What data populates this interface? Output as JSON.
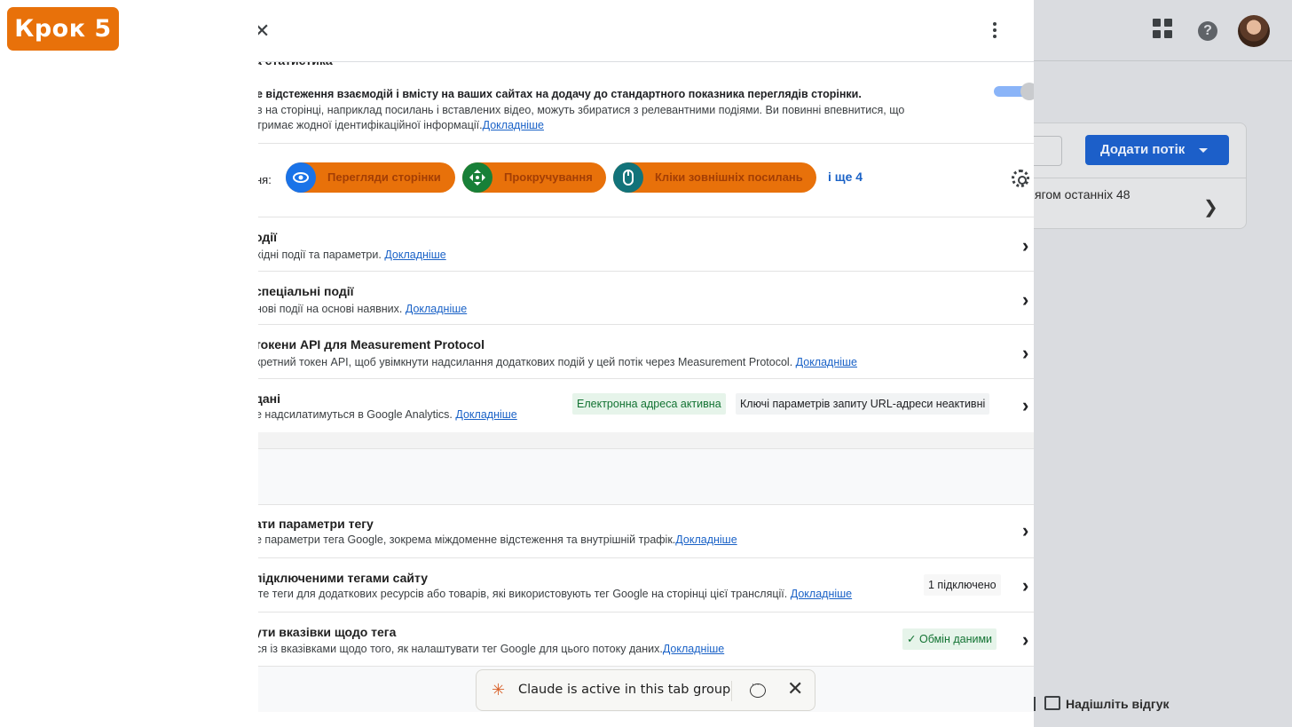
{
  "step_badge": "Крок 5",
  "panel": {
    "close_glyph": "✕",
    "enhanced_measurement": {
      "title_partial": "а статистика",
      "desc_line1": "е відстеження взаємодій і вмісту на ваших сайтах на додачу до стандартного показника переглядів сторінки.",
      "desc_line2": "в на сторінці, наприклад посилань і вставлених відео, можуть збиратися з релевантними подіями. Ви повинні впевнитися, що",
      "desc_line3": "тримає жодної ідентифікаційної інформації.",
      "learn_more": "Докладніше",
      "toggle_on": true
    },
    "measuring": {
      "label": "ня:",
      "pills": [
        {
          "label": "Перегляди сторінки",
          "icon": "eye-icon",
          "color": "#1a73e8"
        },
        {
          "label": "Прокручування",
          "icon": "scroll-arrows-icon",
          "color": "#188038"
        },
        {
          "label": "Кліки зовнішніх посилань",
          "icon": "mouse-icon",
          "color": "#12737a"
        }
      ],
      "more": "і ще 4"
    },
    "rows": [
      {
        "title": "одії",
        "desc": "хідні події та параметри. ",
        "link": "Докладніше"
      },
      {
        "title": "спеціальні події",
        "desc": "нові події на основі наявних. ",
        "link": "Докладніше"
      },
      {
        "title": "токени API для Measurement Protocol",
        "desc": "кретний токен API, щоб увімкнути надсилання додаткових подій у цей потік через Measurement Protocol. ",
        "link": "Докладніше"
      },
      {
        "title": "дані",
        "desc": "е надсилатимуться в Google Analytics. ",
        "link": "Докладніше",
        "chip_green": "Електронна адреса активна",
        "chip_grey": "Ключі параметрів запиту URL-адреси неактивні"
      }
    ],
    "tag_rows": [
      {
        "title": "ати параметри тегу",
        "desc": "е параметри тега Google, зокрема міждоменне відстеження та внутрішній трафік.",
        "link": "Докладніше"
      },
      {
        "title": "підключеними тегами сайту",
        "desc": "іте теги для додаткових ресурсів або товарів, які використовують тег Google на сторінці цієї трансляції. ",
        "link": "Докладніше",
        "chip": "1 підключено"
      },
      {
        "title": "ути вказівки щодо тега",
        "desc": "ся із вказівками щодо того, як налаштувати тег Google для цього потоку даних.",
        "link": "Докладніше",
        "chip": "Обмін даними",
        "chip_check": "✓"
      }
    ]
  },
  "backdrop": {
    "help_glyph": "?",
    "add_stream": "Додати потік",
    "card_text": "ягом останніх 48",
    "feedback": "Надішліть відгук"
  },
  "claude_bar": {
    "star": "✳",
    "text": "Claude is active in this tab group",
    "close": "✕"
  }
}
